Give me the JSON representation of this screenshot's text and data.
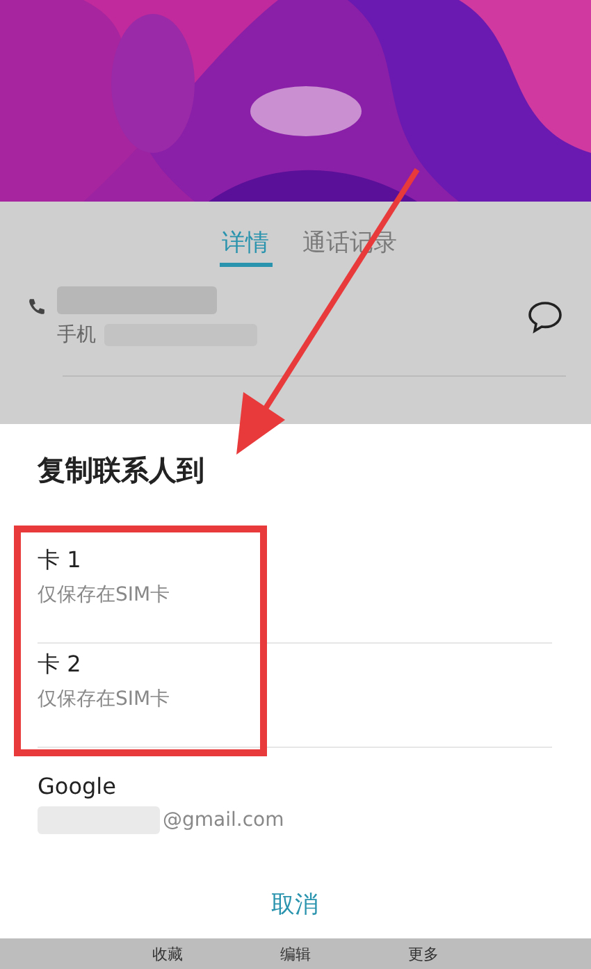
{
  "tabs": [
    {
      "label": "详情",
      "selected": true
    },
    {
      "label": "通话记录",
      "selected": false
    }
  ],
  "phone": {
    "label": "手机"
  },
  "dialog": {
    "title": "复制联系人到",
    "options": [
      {
        "name": "卡 1",
        "detail": "仅保存在SIM卡",
        "boxed": true
      },
      {
        "name": "卡 2",
        "detail": "仅保存在SIM卡",
        "boxed": true
      },
      {
        "name": "Google",
        "detail": "@gmail.com",
        "boxed": false
      }
    ],
    "cancel": "取消"
  },
  "bottom_bar": [
    "收藏",
    "编辑",
    "更多"
  ]
}
